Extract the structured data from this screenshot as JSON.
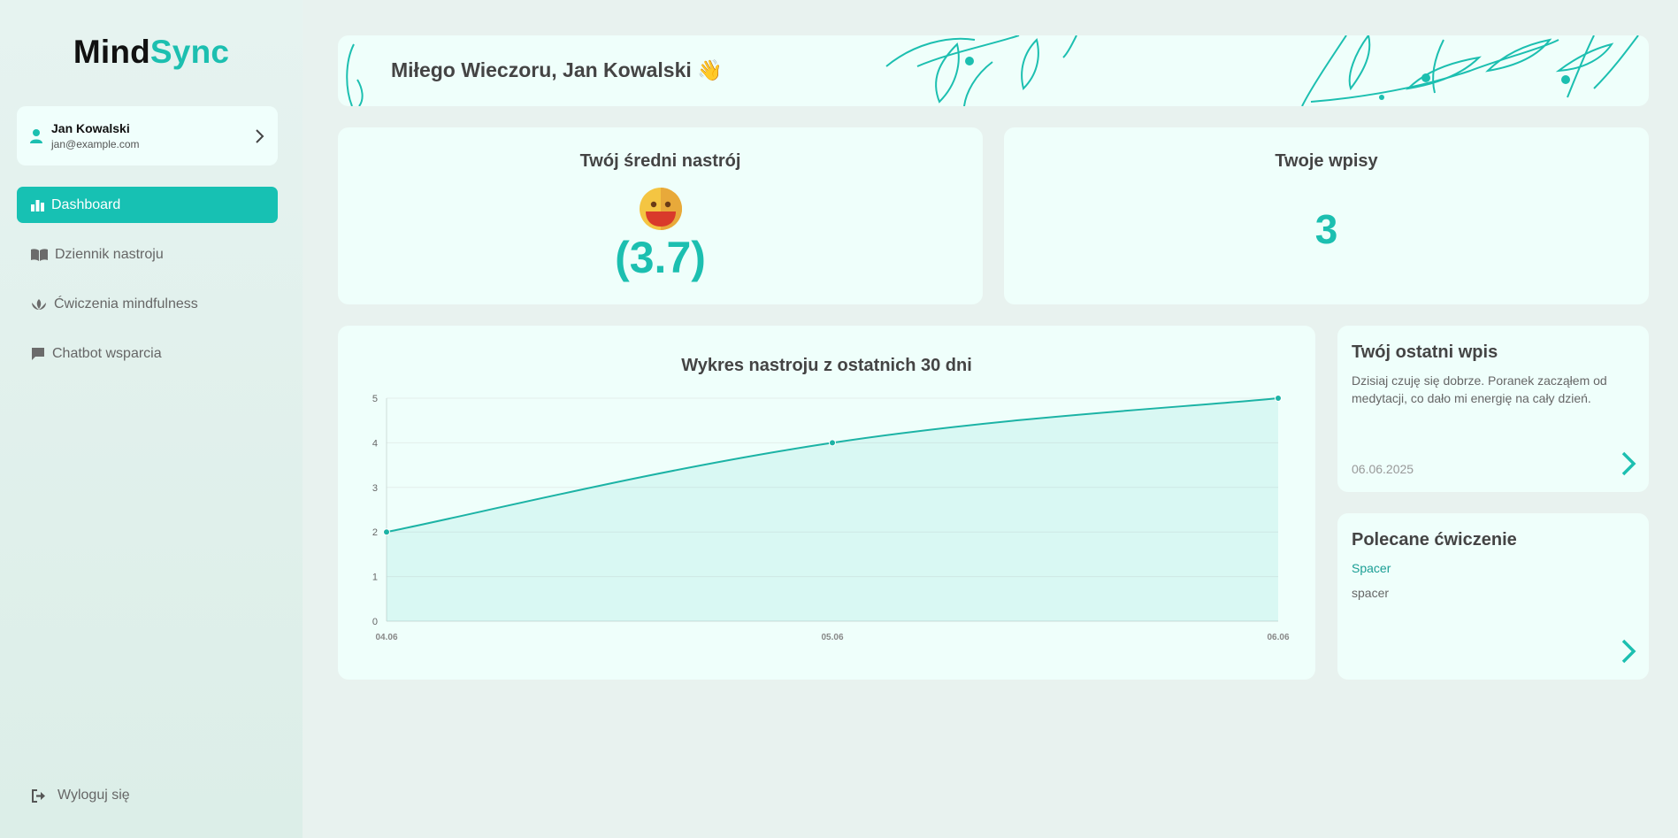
{
  "app": {
    "brand_part1": "Mind",
    "brand_part2": "Sync"
  },
  "user": {
    "name": "Jan Kowalski",
    "email": "jan@example.com"
  },
  "nav": [
    {
      "label": "Dashboard",
      "icon": "chart-bar-icon",
      "active": true
    },
    {
      "label": "Dziennik nastroju",
      "icon": "book-open-icon",
      "active": false
    },
    {
      "label": "Ćwiczenia mindfulness",
      "icon": "lotus-icon",
      "active": false
    },
    {
      "label": "Chatbot wsparcia",
      "icon": "chat-bubble-icon",
      "active": false
    }
  ],
  "logout": {
    "label": "Wyloguj się",
    "icon": "sign-out-icon"
  },
  "greeting": {
    "text": "Miłego Wieczoru, Jan Kowalski 👋"
  },
  "mood_card": {
    "title": "Twój średni nastrój",
    "emoji": "😛",
    "value": "(3.7)"
  },
  "entries_card": {
    "title": "Twoje wpisy",
    "count": "3"
  },
  "chart_card": {
    "title": "Wykres nastroju z ostatnich 30 dni"
  },
  "last_entry": {
    "title": "Twój ostatni wpis",
    "text": "Dzisiaj czuję się dobrze. Poranek zacząłem od medytacji, co dało mi energię na cały dzień.",
    "date": "06.06.2025"
  },
  "recommended": {
    "title": "Polecane ćwiczenie",
    "name": "Spacer",
    "description": "spacer"
  },
  "colors": {
    "accent": "#1cbfb0",
    "card_bg": "#effffb",
    "page_bg": "#e8f2ef"
  },
  "chart_data": {
    "type": "area",
    "title": "Wykres nastroju z ostatnich 30 dni",
    "x": [
      "04.06",
      "05.06",
      "06.06"
    ],
    "series": [
      {
        "values": [
          2,
          4,
          5
        ]
      }
    ],
    "ylim": [
      0,
      5
    ],
    "yticks": [
      "0",
      "1",
      "2",
      "3",
      "4",
      "5"
    ],
    "grid": true,
    "legend": "none"
  }
}
